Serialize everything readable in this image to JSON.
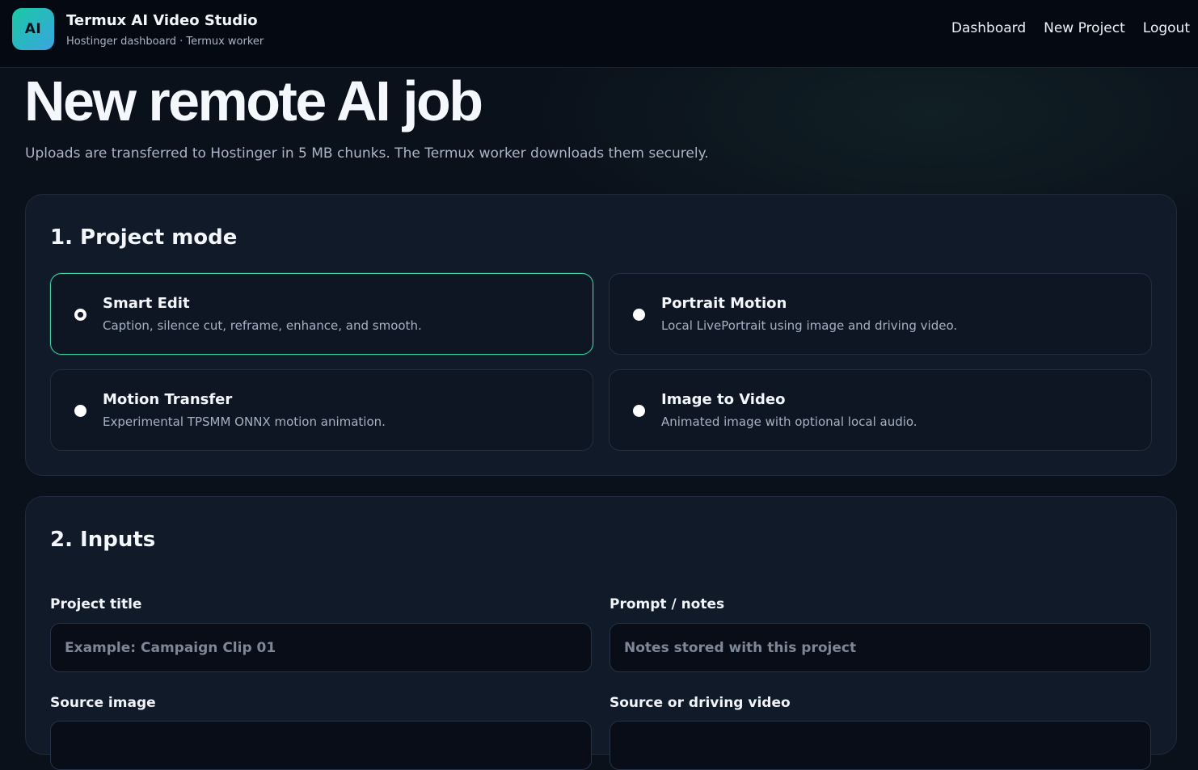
{
  "header": {
    "logo_text": "AI",
    "title": "Termux AI Video Studio",
    "subtitle": "Hostinger dashboard · Termux worker",
    "nav": [
      {
        "label": "Dashboard"
      },
      {
        "label": "New Project"
      },
      {
        "label": "Logout"
      }
    ]
  },
  "hero": {
    "title": "New remote AI job",
    "subtitle": "Uploads are transferred to Hostinger in 5 MB chunks. The Termux worker downloads them securely."
  },
  "mode_section": {
    "title": "1. Project mode",
    "options": [
      {
        "title": "Smart Edit",
        "desc": "Caption, silence cut, reframe, enhance, and smooth.",
        "selected": true
      },
      {
        "title": "Portrait Motion",
        "desc": "Local LivePortrait using image and driving video.",
        "selected": false
      },
      {
        "title": "Motion Transfer",
        "desc": "Experimental TPSMM ONNX motion animation.",
        "selected": false
      },
      {
        "title": "Image to Video",
        "desc": "Animated image with optional local audio.",
        "selected": false
      }
    ]
  },
  "inputs_section": {
    "title": "2. Inputs",
    "project_title": {
      "label": "Project title",
      "value": "",
      "placeholder": "Example: Campaign Clip 01"
    },
    "prompt": {
      "label": "Prompt / notes",
      "value": "",
      "placeholder": "Notes stored with this project"
    },
    "source_image": {
      "label": "Source image"
    },
    "source_video": {
      "label": "Source or driving video"
    }
  },
  "colors": {
    "accent": "#3fd2a0",
    "logo_gradient_start": "#19c9a3",
    "logo_gradient_end": "#3aa5e0",
    "background": "#0b111b",
    "card": "#111a28"
  }
}
